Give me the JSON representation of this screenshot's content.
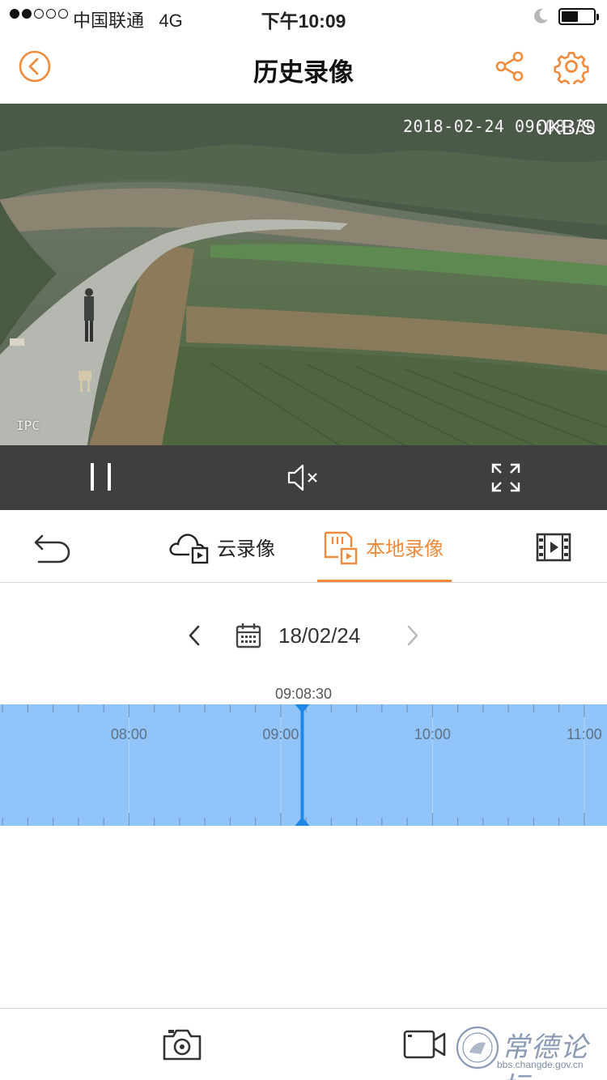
{
  "status_bar": {
    "carrier": "中国联通",
    "network": "4G",
    "time": "下午10:09",
    "signal_bars_filled": 2,
    "signal_bars_total": 5,
    "battery_level": 0.4
  },
  "nav": {
    "title": "历史录像",
    "back_icon": "chevron-left-circle-icon",
    "share_icon": "share-icon",
    "settings_icon": "gear-icon",
    "accent_color": "#f08a3c"
  },
  "video": {
    "osd_timestamp": "2018-02-24 09:08:30",
    "bitrate": "0KB/S",
    "camera_label": "IPC"
  },
  "video_controls": {
    "pause_icon": "pause-icon",
    "mute_icon": "speaker-muted-icon",
    "fullscreen_icon": "fullscreen-icon"
  },
  "tabs": {
    "back_icon": "undo-arrow-icon",
    "cloud_label": "云录像",
    "local_label": "本地录像",
    "active": "local",
    "film_icon": "film-strip-icon"
  },
  "date_picker": {
    "date": "18/02/24",
    "prev_icon": "chevron-left-icon",
    "next_icon": "chevron-right-icon",
    "calendar_icon": "calendar-icon"
  },
  "timeline": {
    "cursor_time": "09:08:30",
    "hour_labels": [
      "08:00",
      "09:00",
      "10:00",
      "11:00"
    ],
    "hours_visible": [
      7.15,
      11.15
    ],
    "cursor_hour": 9.1417,
    "bar_color": "#91c4f9",
    "cursor_color": "#1e88e5"
  },
  "bottom_bar": {
    "snapshot_icon": "camera-icon",
    "record_icon": "video-record-icon"
  },
  "watermark": {
    "title": "常德论坛",
    "url": "bbs.changde.gov.cn"
  }
}
